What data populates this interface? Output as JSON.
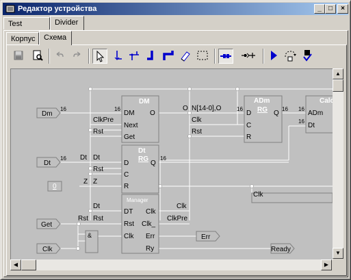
{
  "window": {
    "title": "Редактор устройства",
    "minimize": "_",
    "maximize": "□",
    "close": "×"
  },
  "tabs_top": [
    {
      "label": "Test Divider"
    },
    {
      "label": "Divider"
    }
  ],
  "tabs_sub": [
    {
      "label": "Корпус"
    },
    {
      "label": "Схема"
    }
  ],
  "toolbar": {
    "buttons": [
      {
        "icon": "save-icon"
      },
      {
        "icon": "print-preview-icon"
      },
      {
        "icon": "undo-icon"
      },
      {
        "icon": "redo-icon"
      },
      {
        "icon": "pointer-icon"
      },
      {
        "icon": "wire-down-icon"
      },
      {
        "icon": "wire-fork-icon"
      },
      {
        "icon": "bus-corner-icon"
      },
      {
        "icon": "bus-fork-icon"
      },
      {
        "icon": "eraser-icon"
      },
      {
        "icon": "select-rect-icon"
      },
      {
        "icon": "bus-connect-icon"
      },
      {
        "icon": "pin-connect-icon"
      },
      {
        "icon": "run-icon"
      },
      {
        "icon": "step-icon"
      },
      {
        "icon": "check-icon"
      }
    ]
  },
  "schematic": {
    "inputs": [
      "Dm",
      "Dt",
      "0",
      "Get",
      "Clk"
    ],
    "outputs": [
      "Err",
      "Ready"
    ],
    "blocks": {
      "dm": {
        "title": "DM",
        "pins_left": [
          "DM",
          "Next",
          "Get"
        ],
        "pin_right": "O"
      },
      "dt": {
        "title": "Dt",
        "subtitle": "RG",
        "pins_left": [
          "D",
          "C",
          "R"
        ],
        "pin_right": "Q"
      },
      "manager": {
        "title": "Manager",
        "pins_left": [
          "DT",
          "Rst",
          "Clk"
        ],
        "pins_right": [
          "Clk",
          "Clk_",
          "Err",
          "Ry"
        ]
      },
      "adm": {
        "title": "ADm",
        "subtitle": "RG",
        "pins_left": [
          "D",
          "C",
          "R"
        ],
        "pin_right": "Q"
      },
      "calc": {
        "title": "Calc",
        "pins_left": [
          "ADm",
          "Dt"
        ]
      },
      "and_gate": {
        "symbol": "&"
      }
    },
    "labels": {
      "w16": "16",
      "clkpre": "ClkPre",
      "rst": "Rst",
      "dt": "Dt",
      "z": "Z",
      "o": "O",
      "n_bus": "N[14-0],O",
      "clk": "Clk"
    }
  },
  "colors": {
    "accent": "#0a246a",
    "tool_blue": "#0000cc",
    "canvas": "#c0c0c0"
  }
}
